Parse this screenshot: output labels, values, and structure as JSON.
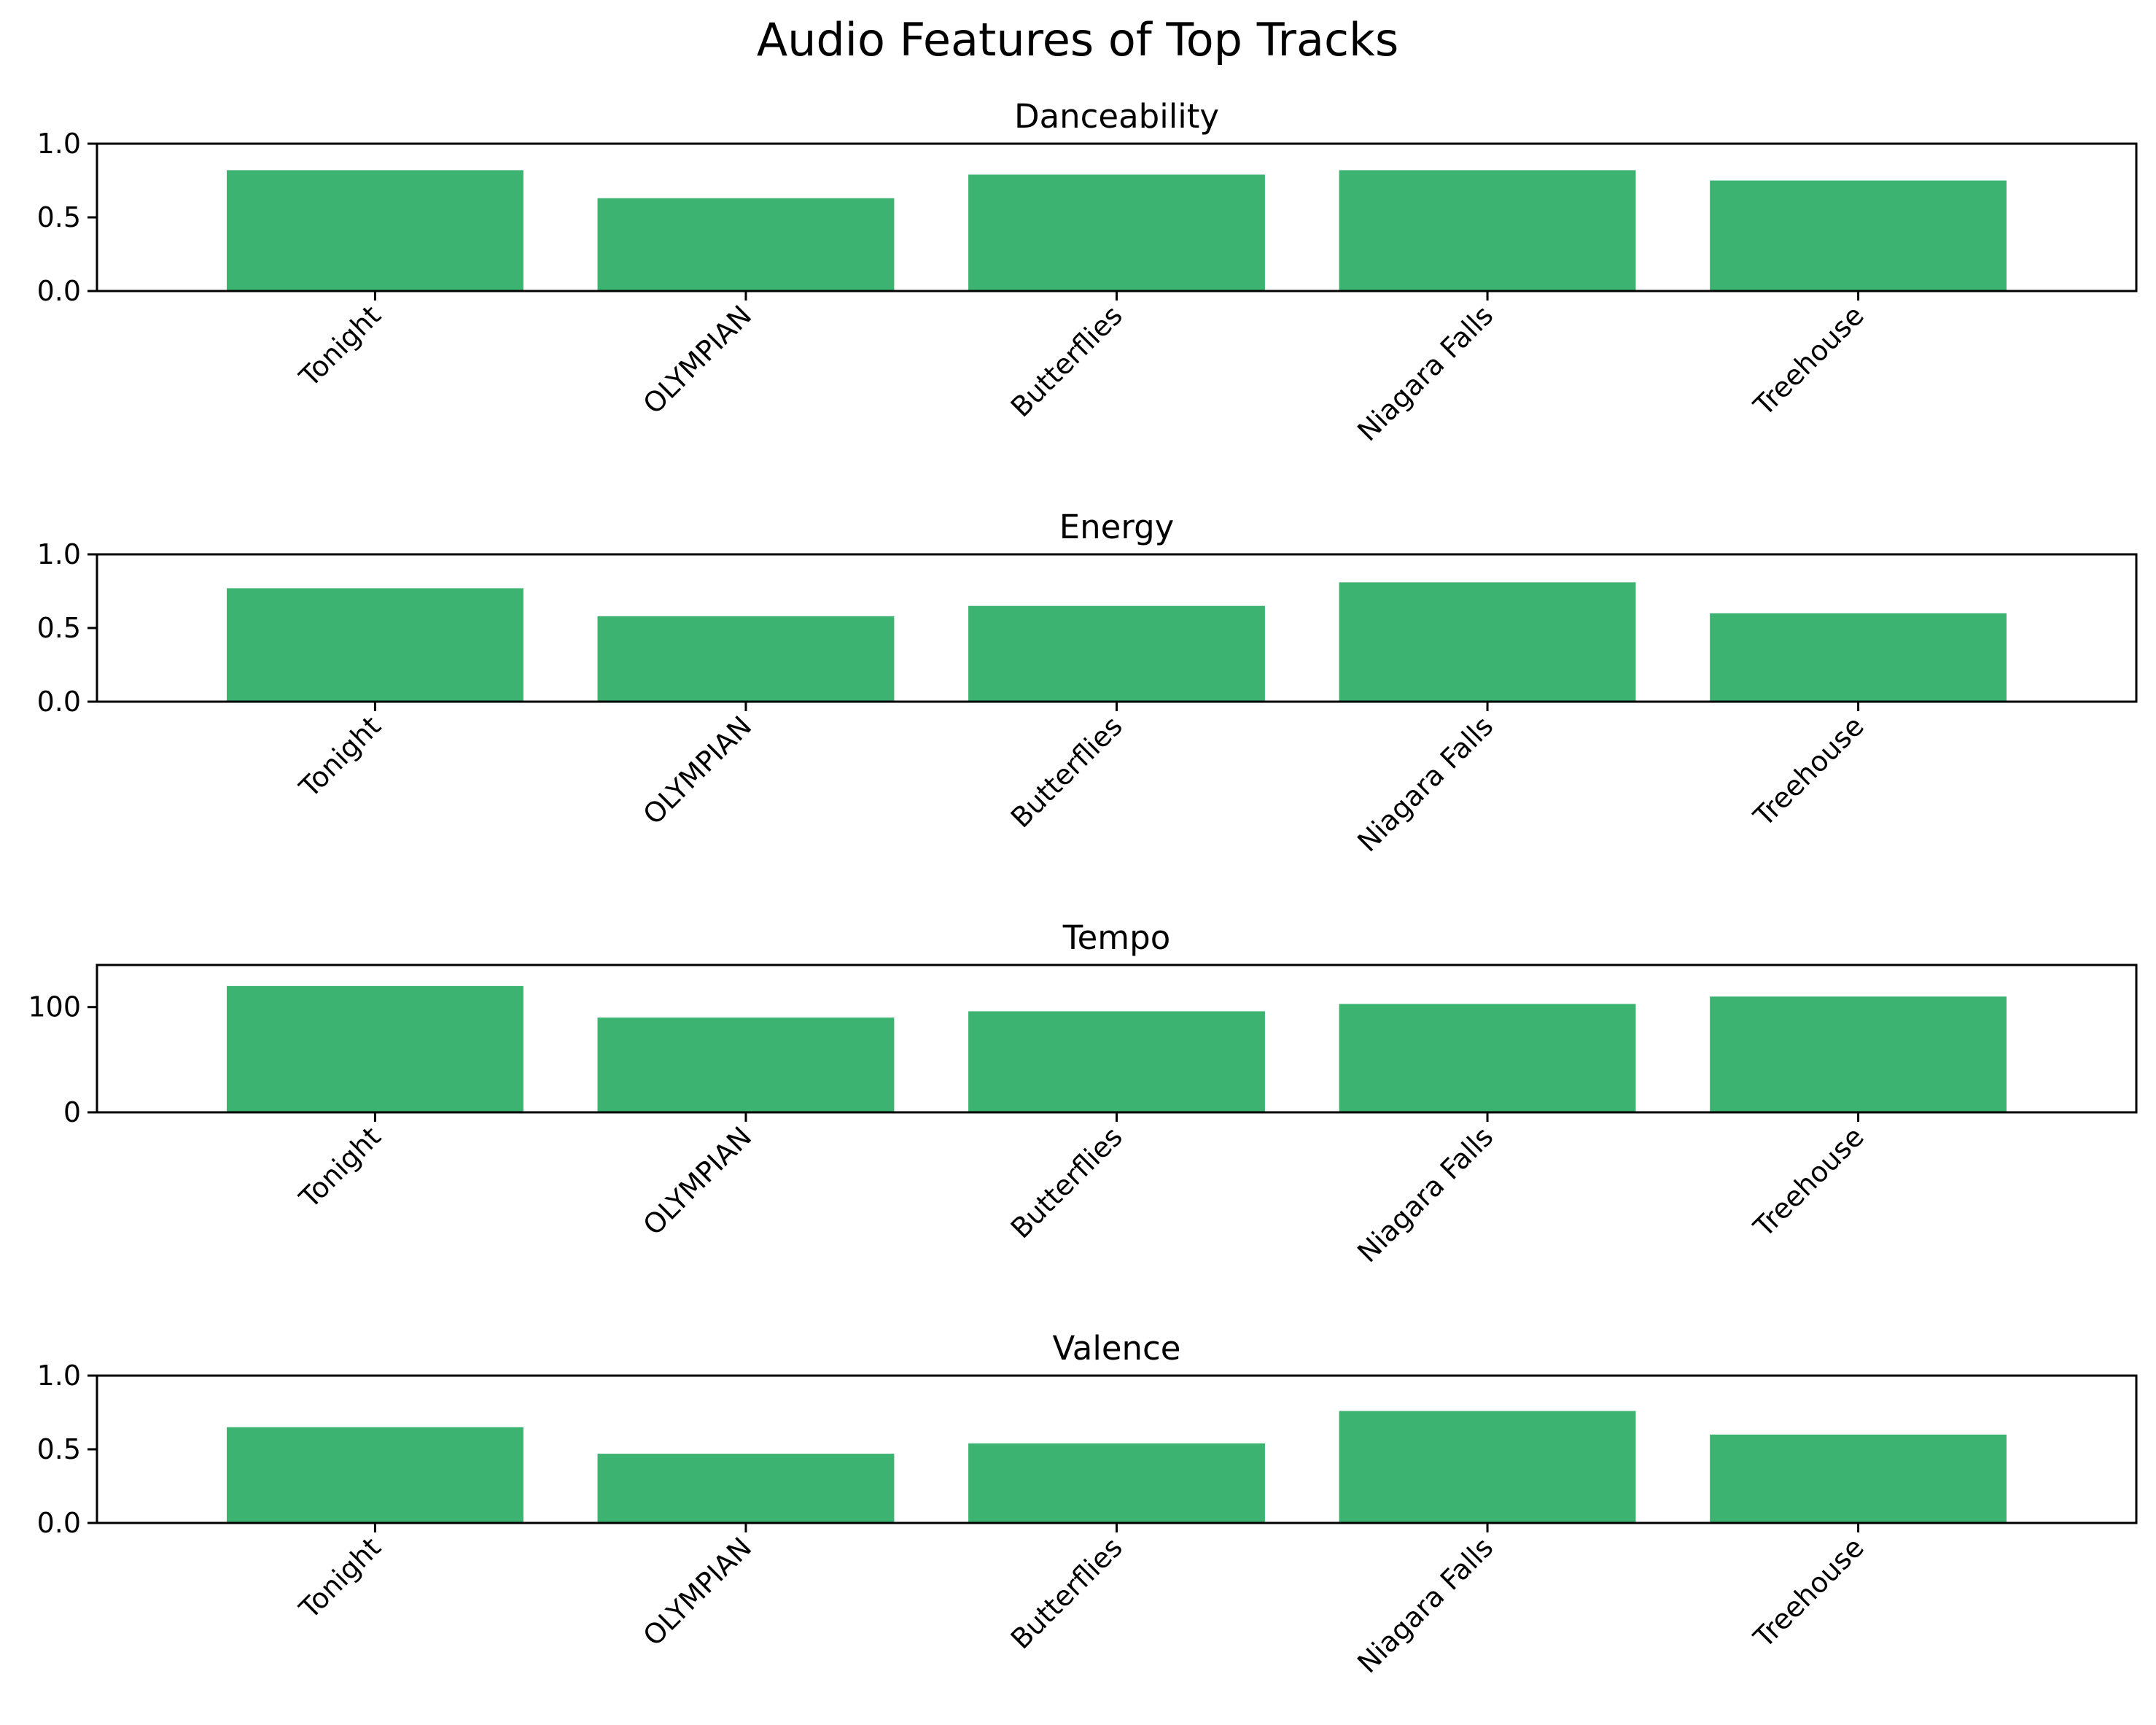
{
  "figure": {
    "title": "Audio Features of Top Tracks",
    "bar_color": "#3cb371"
  },
  "chart_data": [
    {
      "type": "bar",
      "title": "Danceability",
      "xlabel": "",
      "ylabel": "",
      "categories": [
        "Tonight",
        "OLYMPIAN",
        "Butterflies",
        "Niagara Falls",
        "Treehouse"
      ],
      "values": [
        0.82,
        0.63,
        0.79,
        0.82,
        0.75
      ],
      "ylim": [
        0,
        1.0
      ],
      "yticks": [
        0.0,
        0.5,
        1.0
      ],
      "ytick_labels": [
        "0.0",
        "0.5",
        "1.0"
      ],
      "grid": false,
      "legend": "none"
    },
    {
      "type": "bar",
      "title": "Energy",
      "xlabel": "",
      "ylabel": "",
      "categories": [
        "Tonight",
        "OLYMPIAN",
        "Butterflies",
        "Niagara Falls",
        "Treehouse"
      ],
      "values": [
        0.77,
        0.58,
        0.65,
        0.81,
        0.6
      ],
      "ylim": [
        0,
        1.0
      ],
      "yticks": [
        0.0,
        0.5,
        1.0
      ],
      "ytick_labels": [
        "0.0",
        "0.5",
        "1.0"
      ],
      "grid": false,
      "legend": "none"
    },
    {
      "type": "bar",
      "title": "Tempo",
      "xlabel": "",
      "ylabel": "",
      "categories": [
        "Tonight",
        "OLYMPIAN",
        "Butterflies",
        "Niagara Falls",
        "Treehouse"
      ],
      "values": [
        120,
        90,
        96,
        103,
        110
      ],
      "ylim": [
        0,
        140
      ],
      "yticks": [
        0,
        100
      ],
      "ytick_labels": [
        "0",
        "100"
      ],
      "grid": false,
      "legend": "none"
    },
    {
      "type": "bar",
      "title": "Valence",
      "xlabel": "",
      "ylabel": "",
      "categories": [
        "Tonight",
        "OLYMPIAN",
        "Butterflies",
        "Niagara Falls",
        "Treehouse"
      ],
      "values": [
        0.65,
        0.47,
        0.54,
        0.76,
        0.6
      ],
      "ylim": [
        0,
        1.0
      ],
      "yticks": [
        0.0,
        0.5,
        1.0
      ],
      "ytick_labels": [
        "0.0",
        "0.5",
        "1.0"
      ],
      "grid": false,
      "legend": "none"
    }
  ]
}
